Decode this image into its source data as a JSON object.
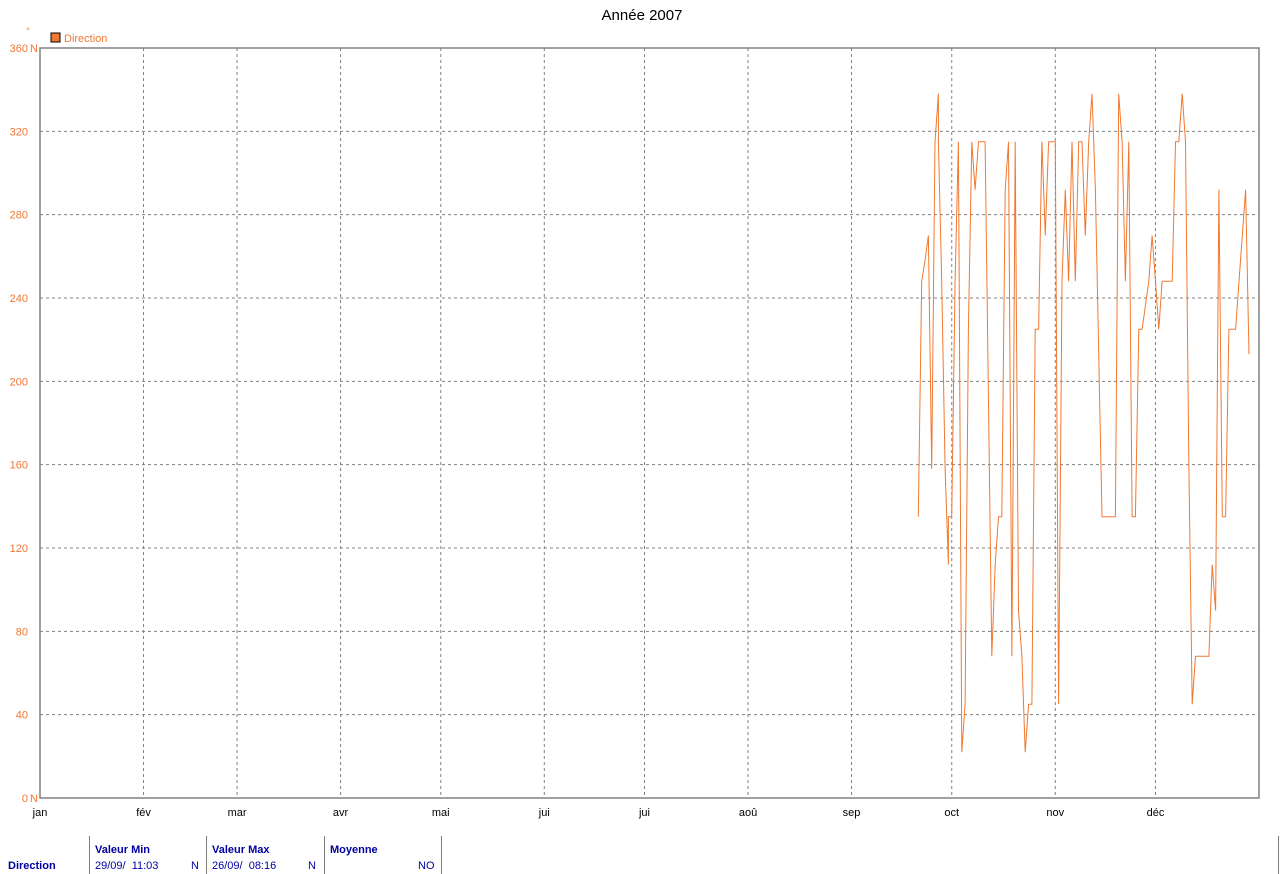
{
  "chart_data": {
    "type": "line",
    "title": "Année 2007",
    "yunit": "°",
    "ylim": [
      0,
      360
    ],
    "y_ticks": [
      {
        "value": 0,
        "label": "0",
        "suffix": "N"
      },
      {
        "value": 40,
        "label": "40",
        "suffix": ""
      },
      {
        "value": 80,
        "label": "80",
        "suffix": ""
      },
      {
        "value": 120,
        "label": "120",
        "suffix": ""
      },
      {
        "value": 160,
        "label": "160",
        "suffix": ""
      },
      {
        "value": 200,
        "label": "200",
        "suffix": ""
      },
      {
        "value": 240,
        "label": "240",
        "suffix": ""
      },
      {
        "value": 280,
        "label": "280",
        "suffix": ""
      },
      {
        "value": 320,
        "label": "320",
        "suffix": ""
      },
      {
        "value": 360,
        "label": "360",
        "suffix": "N"
      }
    ],
    "x_ticks": [
      {
        "label": "jan",
        "date": "2007-01-01"
      },
      {
        "label": "fév",
        "date": "2007-02-01"
      },
      {
        "label": "mar",
        "date": "2007-03-01"
      },
      {
        "label": "avr",
        "date": "2007-04-01"
      },
      {
        "label": "mai",
        "date": "2007-05-01"
      },
      {
        "label": "jui",
        "date": "2007-06-01"
      },
      {
        "label": "jui",
        "date": "2007-07-01"
      },
      {
        "label": "aoû",
        "date": "2007-08-01"
      },
      {
        "label": "sep",
        "date": "2007-09-01"
      },
      {
        "label": "oct",
        "date": "2007-10-01"
      },
      {
        "label": "nov",
        "date": "2007-11-01"
      },
      {
        "label": "déc",
        "date": "2007-12-01"
      }
    ],
    "xlim": [
      "2007-01-01",
      "2008-01-01"
    ],
    "grid": true,
    "legend_position": "top-left",
    "series": [
      {
        "name": "Direction",
        "color": "#f07830",
        "points": [
          [
            "2007-09-21",
            135
          ],
          [
            "2007-09-22",
            248
          ],
          [
            "2007-09-23",
            258
          ],
          [
            "2007-09-24",
            270
          ],
          [
            "2007-09-25",
            158
          ],
          [
            "2007-09-26",
            315
          ],
          [
            "2007-09-27",
            338
          ],
          [
            "2007-09-27",
            315
          ],
          [
            "2007-09-28",
            248
          ],
          [
            "2007-09-29",
            158
          ],
          [
            "2007-09-30",
            112
          ],
          [
            "2007-09-30",
            135
          ],
          [
            "2007-10-01",
            135
          ],
          [
            "2007-10-02",
            248
          ],
          [
            "2007-10-03",
            315
          ],
          [
            "2007-10-04",
            22
          ],
          [
            "2007-10-05",
            45
          ],
          [
            "2007-10-06",
            225
          ],
          [
            "2007-10-07",
            315
          ],
          [
            "2007-10-08",
            292
          ],
          [
            "2007-10-09",
            315
          ],
          [
            "2007-10-10",
            315
          ],
          [
            "2007-10-11",
            315
          ],
          [
            "2007-10-13",
            68
          ],
          [
            "2007-10-14",
            112
          ],
          [
            "2007-10-15",
            135
          ],
          [
            "2007-10-16",
            135
          ],
          [
            "2007-10-17",
            292
          ],
          [
            "2007-10-18",
            315
          ],
          [
            "2007-10-18",
            315
          ],
          [
            "2007-10-19",
            68
          ],
          [
            "2007-10-20",
            315
          ],
          [
            "2007-10-21",
            90
          ],
          [
            "2007-10-22",
            68
          ],
          [
            "2007-10-23",
            22
          ],
          [
            "2007-10-24",
            45
          ],
          [
            "2007-10-25",
            45
          ],
          [
            "2007-10-26",
            225
          ],
          [
            "2007-10-27",
            225
          ],
          [
            "2007-10-28",
            315
          ],
          [
            "2007-10-29",
            270
          ],
          [
            "2007-10-30",
            315
          ],
          [
            "2007-10-31",
            315
          ],
          [
            "2007-11-01",
            315
          ],
          [
            "2007-11-02",
            45
          ],
          [
            "2007-11-03",
            248
          ],
          [
            "2007-11-04",
            292
          ],
          [
            "2007-11-05",
            248
          ],
          [
            "2007-11-06",
            315
          ],
          [
            "2007-11-07",
            248
          ],
          [
            "2007-11-08",
            315
          ],
          [
            "2007-11-09",
            315
          ],
          [
            "2007-11-10",
            270
          ],
          [
            "2007-11-11",
            315
          ],
          [
            "2007-11-12",
            338
          ],
          [
            "2007-11-13",
            292
          ],
          [
            "2007-11-15",
            135
          ],
          [
            "2007-11-16",
            135
          ],
          [
            "2007-11-18",
            135
          ],
          [
            "2007-11-19",
            135
          ],
          [
            "2007-11-20",
            338
          ],
          [
            "2007-11-21",
            315
          ],
          [
            "2007-11-22",
            248
          ],
          [
            "2007-11-23",
            315
          ],
          [
            "2007-11-24",
            135
          ],
          [
            "2007-11-25",
            135
          ],
          [
            "2007-11-26",
            225
          ],
          [
            "2007-11-27",
            225
          ],
          [
            "2007-11-29",
            248
          ],
          [
            "2007-11-30",
            270
          ],
          [
            "2007-12-01",
            248
          ],
          [
            "2007-12-02",
            225
          ],
          [
            "2007-12-03",
            248
          ],
          [
            "2007-12-05",
            248
          ],
          [
            "2007-12-06",
            248
          ],
          [
            "2007-12-07",
            315
          ],
          [
            "2007-12-08",
            315
          ],
          [
            "2007-12-09",
            338
          ],
          [
            "2007-12-10",
            315
          ],
          [
            "2007-12-11",
            158
          ],
          [
            "2007-12-12",
            45
          ],
          [
            "2007-12-13",
            68
          ],
          [
            "2007-12-15",
            68
          ],
          [
            "2007-12-17",
            68
          ],
          [
            "2007-12-18",
            112
          ],
          [
            "2007-12-19",
            90
          ],
          [
            "2007-12-20",
            292
          ],
          [
            "2007-12-21",
            135
          ],
          [
            "2007-12-22",
            135
          ],
          [
            "2007-12-23",
            225
          ],
          [
            "2007-12-25",
            225
          ],
          [
            "2007-12-26",
            248
          ],
          [
            "2007-12-27",
            270
          ],
          [
            "2007-12-28",
            292
          ],
          [
            "2007-12-29",
            213
          ]
        ]
      }
    ]
  },
  "stats": {
    "row_label": "Direction",
    "columns": [
      {
        "header": "Valeur Min",
        "value": "29/09/  11:03",
        "cardinal": "N"
      },
      {
        "header": "Valeur Max",
        "value": "26/09/  08:16",
        "cardinal": "N"
      },
      {
        "header": "Moyenne",
        "value": "",
        "cardinal": "NO"
      }
    ]
  }
}
